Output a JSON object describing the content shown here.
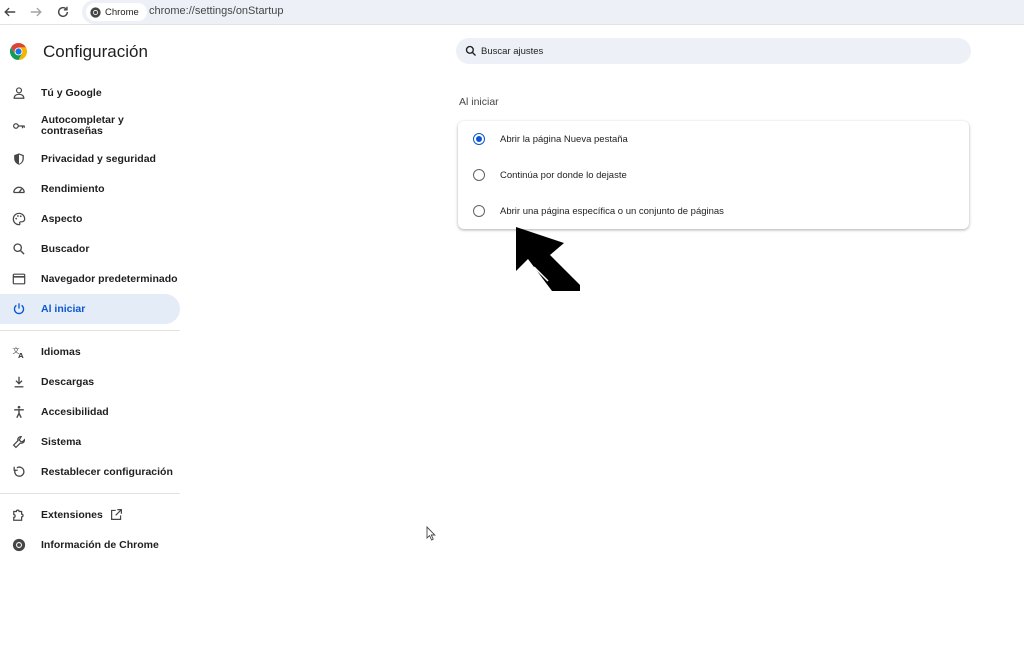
{
  "browser": {
    "chip_label": "Chrome",
    "url": "chrome://settings/onStartup"
  },
  "header": {
    "title": "Configuración"
  },
  "search": {
    "placeholder": "Buscar ajustes"
  },
  "sidebar": {
    "items": [
      {
        "label": "Tú y Google",
        "icon": "person-icon"
      },
      {
        "label": "Autocompletar y\ncontraseñas",
        "icon": "key-icon"
      },
      {
        "label": "Privacidad y seguridad",
        "icon": "shield-icon"
      },
      {
        "label": "Rendimiento",
        "icon": "speedometer-icon"
      },
      {
        "label": "Aspecto",
        "icon": "palette-icon"
      },
      {
        "label": "Buscador",
        "icon": "search-icon"
      },
      {
        "label": "Navegador predeterminado",
        "icon": "browser-window-icon"
      },
      {
        "label": "Al iniciar",
        "icon": "power-icon",
        "active": true
      },
      {
        "label": "Idiomas",
        "icon": "translate-icon"
      },
      {
        "label": "Descargas",
        "icon": "download-icon"
      },
      {
        "label": "Accesibilidad",
        "icon": "accessibility-icon"
      },
      {
        "label": "Sistema",
        "icon": "wrench-icon"
      },
      {
        "label": "Restablecer configuración",
        "icon": "reset-icon"
      },
      {
        "label": "Extensiones",
        "icon": "puzzle-icon"
      },
      {
        "label": "Información de Chrome",
        "icon": "chrome-icon"
      }
    ]
  },
  "startup": {
    "section_title": "Al iniciar",
    "options": [
      {
        "label": "Abrir la página Nueva pestaña",
        "checked": true
      },
      {
        "label": "Continúa por donde lo dejaste",
        "checked": false
      },
      {
        "label": "Abrir una página específica o un conjunto de páginas",
        "checked": false
      }
    ]
  },
  "colors": {
    "accent": "#0b57d0",
    "active_bg": "#e4ecf8",
    "surface": "#edf0f6"
  }
}
